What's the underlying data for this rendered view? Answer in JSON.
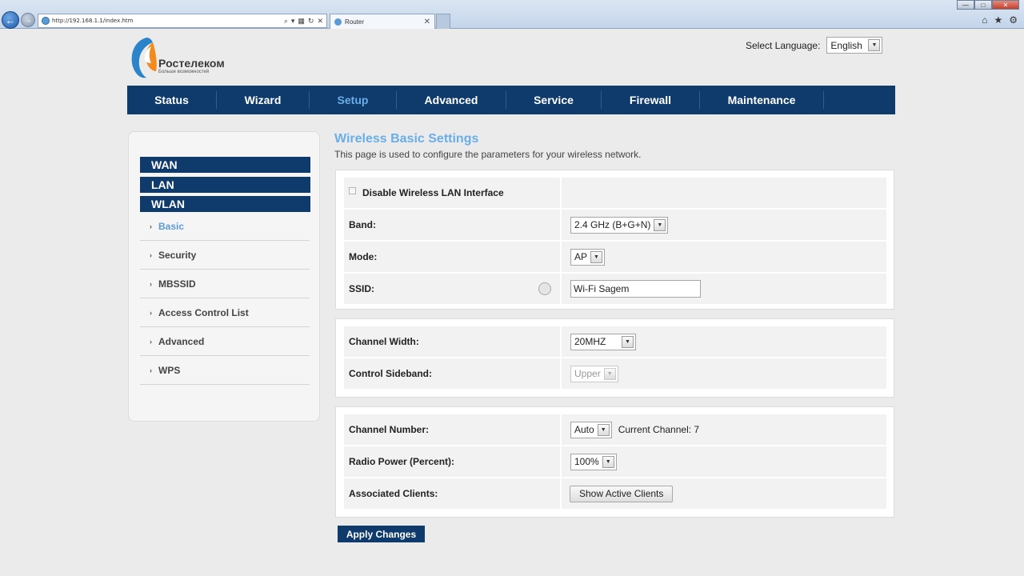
{
  "browser": {
    "url": "http://192.168.1.1/index.htm",
    "tab_title": "Router"
  },
  "logo": {
    "name": "Ростелеком",
    "tagline": "Больше возможностей"
  },
  "language": {
    "label": "Select Language:",
    "value": "English"
  },
  "nav": {
    "items": [
      "Status",
      "Wizard",
      "Setup",
      "Advanced",
      "Service",
      "Firewall",
      "Maintenance"
    ],
    "active": "Setup"
  },
  "sidebar": {
    "headers": [
      "WAN",
      "LAN",
      "WLAN"
    ],
    "items": [
      "Basic",
      "Security",
      "MBSSID",
      "Access Control List",
      "Advanced",
      "WPS"
    ],
    "active": "Basic"
  },
  "page": {
    "title": "Wireless Basic Settings",
    "description": "This page is used to configure the parameters for your wireless network."
  },
  "settings": {
    "disable_wlan_label": "Disable Wireless LAN Interface",
    "band_label": "Band:",
    "band_value": "2.4 GHz (B+G+N)",
    "mode_label": "Mode:",
    "mode_value": "AP",
    "ssid_label": "SSID:",
    "ssid_value": "Wi-Fi Sagem",
    "channel_width_label": "Channel Width:",
    "channel_width_value": "20MHZ",
    "sideband_label": "Control Sideband:",
    "sideband_value": "Upper",
    "channel_number_label": "Channel Number:",
    "channel_number_value": "Auto",
    "current_channel": "Current Channel: 7",
    "radio_power_label": "Radio Power (Percent):",
    "radio_power_value": "100%",
    "clients_label": "Associated Clients:",
    "show_clients_button": "Show Active Clients",
    "apply_button": "Apply Changes"
  },
  "colors": {
    "nav_bg": "#0e3b6b",
    "accent": "#6aaee8"
  }
}
